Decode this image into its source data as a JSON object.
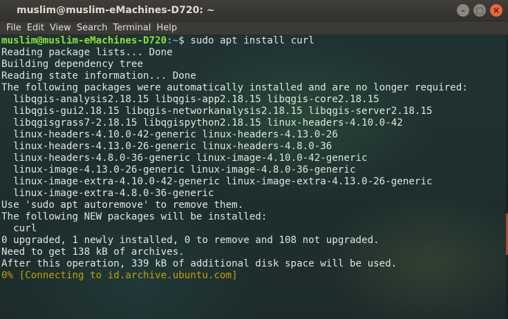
{
  "window": {
    "title": "muslim@muslim-eMachines-D720: ~",
    "buttons": {
      "minimize": "–",
      "maximize": "□",
      "close": "×"
    }
  },
  "menu": {
    "items": [
      "File",
      "Edit",
      "View",
      "Search",
      "Terminal",
      "Help"
    ]
  },
  "terminal": {
    "prompt_user": "muslim@muslim-eMachines-D720",
    "prompt_path": ":~",
    "prompt_symbol": "$ ",
    "command": "sudo apt install curl",
    "output": [
      "Reading package lists... Done",
      "Building dependency tree",
      "Reading state information... Done",
      "The following packages were automatically installed and are no longer required:",
      "  libqgis-analysis2.18.15 libqgis-app2.18.15 libqgis-core2.18.15",
      "  libqgis-gui2.18.15 libqgis-networkanalysis2.18.15 libqgis-server2.18.15",
      "  libqgisgrass7-2.18.15 libqgispython2.18.15 linux-headers-4.10.0-42",
      "  linux-headers-4.10.0-42-generic linux-headers-4.13.0-26",
      "  linux-headers-4.13.0-26-generic linux-headers-4.8.0-36",
      "  linux-headers-4.8.0-36-generic linux-image-4.10.0-42-generic",
      "  linux-image-4.13.0-26-generic linux-image-4.8.0-36-generic",
      "  linux-image-extra-4.10.0-42-generic linux-image-extra-4.13.0-26-generic",
      "  linux-image-extra-4.8.0-36-generic",
      "Use 'sudo apt autoremove' to remove them.",
      "The following NEW packages will be installed:",
      "  curl",
      "0 upgraded, 1 newly installed, 0 to remove and 108 not upgraded.",
      "Need to get 138 kB of archives.",
      "After this operation, 339 kB of additional disk space will be used."
    ],
    "progress_line": "0% [Connecting to id.archive.ubuntu.com]"
  },
  "colors": {
    "prompt_user": "#8ae234",
    "prompt_path": "#729fcf",
    "progress": "#c4a000",
    "close_button": "#e9653a"
  }
}
